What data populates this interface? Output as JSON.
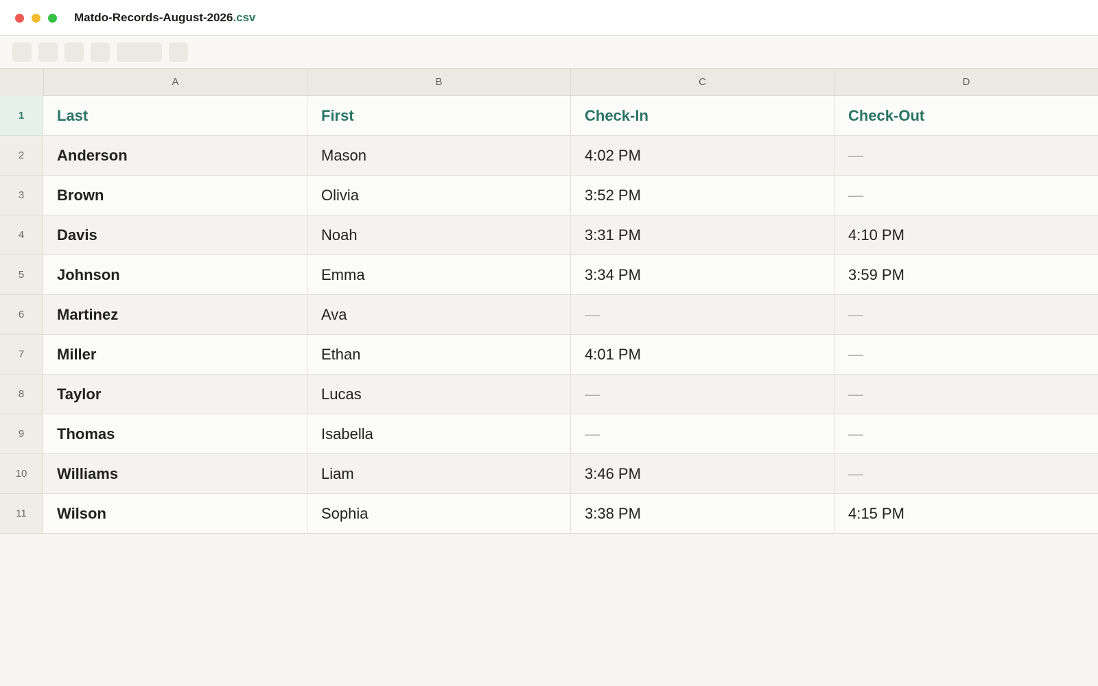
{
  "window": {
    "filename": "Matdo-Records-August-2026",
    "extension": ".csv"
  },
  "colors": {
    "accent": "#2a7561",
    "close": "#ee5a52",
    "minimize": "#f4bb2e",
    "maximize": "#37c147"
  },
  "columns": [
    "A",
    "B",
    "C",
    "D"
  ],
  "header": {
    "row_number": "1",
    "cells": [
      "Last",
      "First",
      "Check-In",
      "Check-Out"
    ]
  },
  "rows": [
    {
      "n": "2",
      "cells": [
        "Anderson",
        "Mason",
        "4:02 PM",
        "—"
      ]
    },
    {
      "n": "3",
      "cells": [
        "Brown",
        "Olivia",
        "3:52 PM",
        "—"
      ]
    },
    {
      "n": "4",
      "cells": [
        "Davis",
        "Noah",
        "3:31 PM",
        "4:10 PM"
      ]
    },
    {
      "n": "5",
      "cells": [
        "Johnson",
        "Emma",
        "3:34 PM",
        "3:59 PM"
      ]
    },
    {
      "n": "6",
      "cells": [
        "Martinez",
        "Ava",
        "—",
        "—"
      ]
    },
    {
      "n": "7",
      "cells": [
        "Miller",
        "Ethan",
        "4:01 PM",
        "—"
      ]
    },
    {
      "n": "8",
      "cells": [
        "Taylor",
        "Lucas",
        "—",
        "—"
      ]
    },
    {
      "n": "9",
      "cells": [
        "Thomas",
        "Isabella",
        "—",
        "—"
      ]
    },
    {
      "n": "10",
      "cells": [
        "Williams",
        "Liam",
        "3:46 PM",
        "—"
      ]
    },
    {
      "n": "11",
      "cells": [
        "Wilson",
        "Sophia",
        "3:38 PM",
        "4:15 PM"
      ]
    }
  ]
}
